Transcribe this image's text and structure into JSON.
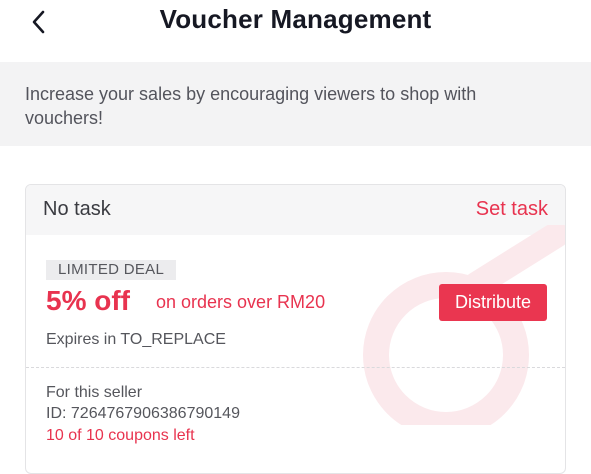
{
  "header": {
    "title": "Voucher Management",
    "back_icon": "chevron-left-icon"
  },
  "banner": {
    "text": "Increase your sales by encouraging viewers to shop with vouchers!"
  },
  "voucher_card": {
    "task_status": "No task",
    "set_task_label": "Set task",
    "deal_badge": "LIMITED DEAL",
    "discount": "5% off",
    "condition": "on orders over RM20",
    "distribute_label": "Distribute",
    "expiry": "Expires in TO_REPLACE",
    "scope": "For this seller",
    "voucher_id": "ID: 7264767906386790149",
    "coupons_left": "10 of 10 coupons left"
  },
  "colors": {
    "accent": "#e8334f",
    "banner_bg": "#f3f3f4",
    "card_head_bg": "#f6f6f7"
  }
}
